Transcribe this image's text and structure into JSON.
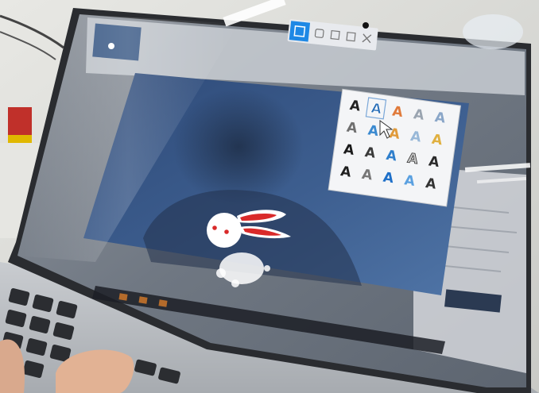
{
  "photo": {
    "subject": "laptop-screen-photo",
    "app": "presentation-editor",
    "slide_art": "rabbit-drawing"
  },
  "screen_toolbar": {
    "icons": [
      "select-icon",
      "shape-icon",
      "copy-icon",
      "window-icon",
      "close-icon"
    ]
  },
  "wordart_gallery": {
    "glyph": "A",
    "styles": [
      {
        "fill": "#222222",
        "stroke": "none"
      },
      {
        "fill": "#2a6fb8",
        "stroke": "#ffffff"
      },
      {
        "fill": "#e07a3a",
        "stroke": "none"
      },
      {
        "fill": "#9aa4b0",
        "stroke": "none"
      },
      {
        "fill": "#8aa6c8",
        "stroke": "none"
      },
      {
        "fill": "#6f6f6f",
        "stroke": "none"
      },
      {
        "fill": "#3b8ad0",
        "stroke": "none"
      },
      {
        "fill": "#e09a3a",
        "stroke": "none"
      },
      {
        "fill": "#98b8d8",
        "stroke": "none"
      },
      {
        "fill": "#e0b040",
        "stroke": "none"
      },
      {
        "fill": "#1a1a1a",
        "stroke": "none"
      },
      {
        "fill": "#3a3a3a",
        "stroke": "none"
      },
      {
        "fill": "#2f7fcc",
        "stroke": "none"
      },
      {
        "fill": "#c8c8c8",
        "stroke": "#333333"
      },
      {
        "fill": "#2a2a2a",
        "stroke": "none"
      },
      {
        "fill": "#1f1f1f",
        "stroke": "none"
      },
      {
        "fill": "#777777",
        "stroke": "none"
      },
      {
        "fill": "#1e6fc8",
        "stroke": "none"
      },
      {
        "fill": "#5aa0e0",
        "stroke": "none"
      },
      {
        "fill": "#333333",
        "stroke": "none"
      }
    ]
  },
  "colors": {
    "slide_blue": "#3f5f8e",
    "rabbit_ear": "#d92a2a",
    "laptop_body": "#b9bcc0"
  }
}
